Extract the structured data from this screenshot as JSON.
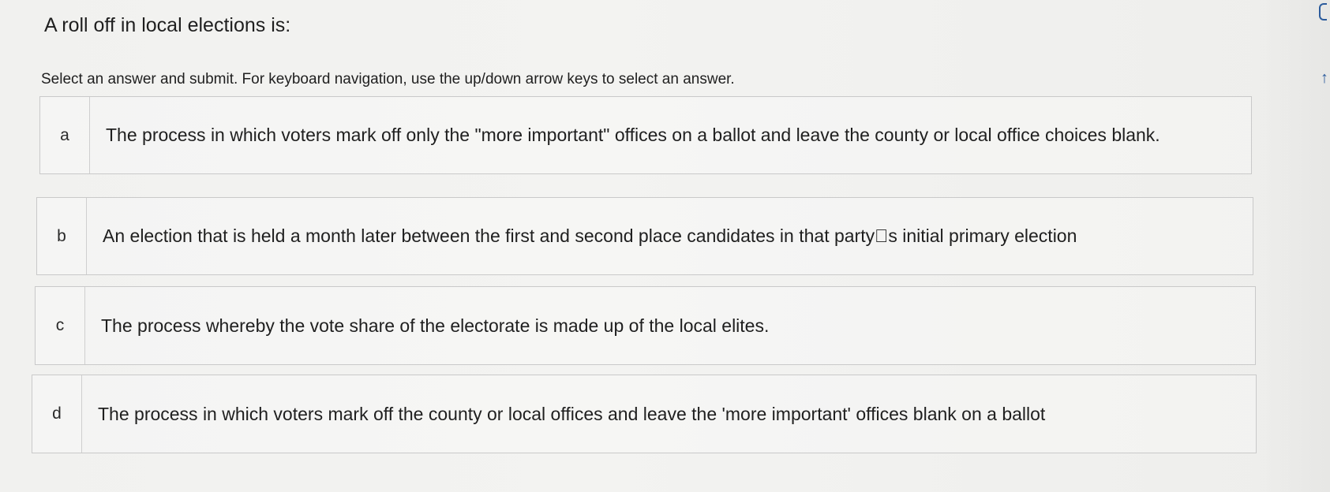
{
  "question": "A roll off in local elections is:",
  "instructions": "Select an answer and submit. For keyboard navigation, use the up/down arrow keys to select an answer.",
  "options": [
    {
      "letter": "a",
      "text": "The process in which voters mark off only the \"more important\" offices on a ballot and leave the county or local office choices blank."
    },
    {
      "letter": "b",
      "text": "An election that is held a month later between the first and second place candidates in that party\u0000s initial primary election"
    },
    {
      "letter": "c",
      "text": "The process whereby the vote share of the electorate is made up of the local elites."
    },
    {
      "letter": "d",
      "text": "The process in which voters mark off the county or local offices and leave the 'more important' offices blank on a ballot"
    }
  ],
  "icons": {
    "edge_top": "panel-tab-icon",
    "edge_arrow": "arrow-icon"
  }
}
